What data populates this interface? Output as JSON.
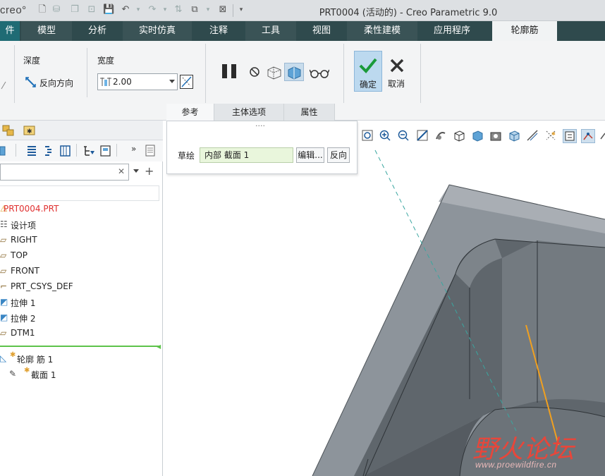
{
  "titlebar": {
    "logo": "creo°",
    "window_title": "PRT0004 (活动的) - Creo Parametric 9.0"
  },
  "menubar": {
    "items": [
      {
        "label": "件"
      },
      {
        "label": "模型"
      },
      {
        "label": "分析"
      },
      {
        "label": "实时仿真"
      },
      {
        "label": "注释"
      },
      {
        "label": "工具"
      },
      {
        "label": "视图"
      },
      {
        "label": "柔性建模"
      },
      {
        "label": "应用程序"
      },
      {
        "label": "轮廓筋"
      }
    ]
  },
  "ribbon": {
    "depth_label": "深度",
    "flip_direction_label": "反向方向",
    "width_label": "宽度",
    "width_value": "2.00",
    "confirm_label": "确定",
    "cancel_label": "取消",
    "tabs": [
      {
        "label": "参考"
      },
      {
        "label": "主体选项"
      },
      {
        "label": "属性"
      }
    ]
  },
  "ref_panel": {
    "handle": "····",
    "sketch_label": "草绘",
    "sketch_value": "内部 截面 1",
    "edit_button": "编辑...",
    "flip_button": "反向"
  },
  "model_tree": {
    "items": [
      {
        "label": "PRT0004.PRT"
      },
      {
        "label": "设计项"
      },
      {
        "label": "RIGHT"
      },
      {
        "label": "TOP"
      },
      {
        "label": "FRONT"
      },
      {
        "label": "PRT_CSYS_DEF"
      },
      {
        "label": "拉伸 1"
      },
      {
        "label": "拉伸 2"
      },
      {
        "label": "DTM1"
      },
      {
        "label": "轮廓 筋 1"
      },
      {
        "label": "截面 1"
      }
    ],
    "root_color": "#e03030"
  },
  "watermark": {
    "title": "野火论坛",
    "url": "www.proewildfire.cn"
  },
  "colors": {
    "menubar": "#2f4a4d",
    "ribbon": "#f3f4f5",
    "model_face": "#8d949b",
    "sketch_line": "#f0a020",
    "axis_line": "#3aa6a0"
  }
}
